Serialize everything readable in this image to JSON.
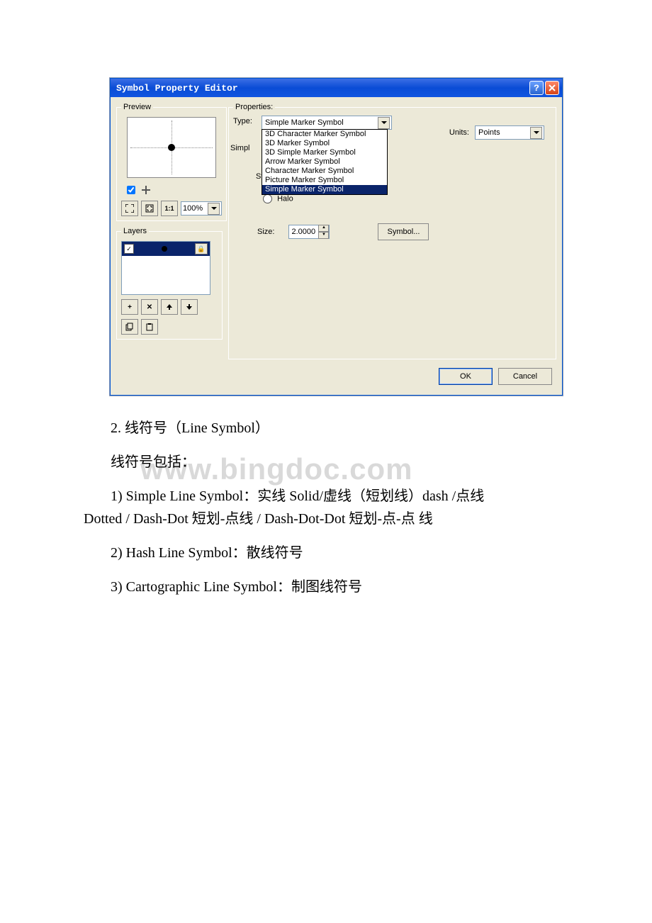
{
  "window": {
    "title": "Symbol Property Editor"
  },
  "preview": {
    "legend": "Preview",
    "zoom_value": "100%"
  },
  "layers": {
    "legend": "Layers"
  },
  "properties": {
    "legend": "Properties:",
    "type_label": "Type:",
    "type_value": "Simple Marker Symbol",
    "type_options": [
      "3D Character Marker Symbol",
      "3D Marker Symbol",
      "3D Simple Marker Symbol",
      "Arrow Marker Symbol",
      "Character Marker Symbol",
      "Picture Marker Symbol",
      "Simple Marker Symbol"
    ],
    "units_label": "Units:",
    "units_value": "Points",
    "tab_simple_prefix": "Simpl",
    "tab_st_prefix": "St",
    "halo_label": "Halo",
    "size_label": "Size:",
    "size_value": "2.0000",
    "symbol_button": "Symbol..."
  },
  "footer": {
    "ok": "OK",
    "cancel": "Cancel"
  },
  "doc": {
    "watermark": "www.bingdoc.com",
    "p1": "2. 线符号（Line Symbol）",
    "p2": "线符号包括：",
    "p3a": "1) Simple Line Symbol：实线 Solid/虚线（短划线）dash /点线",
    "p3b": "Dotted / Dash-Dot 短划-点线 / Dash-Dot-Dot 短划-点-点 线",
    "p4": "2) Hash Line Symbol：散线符号",
    "p5": "3) Cartographic Line Symbol：制图线符号"
  }
}
